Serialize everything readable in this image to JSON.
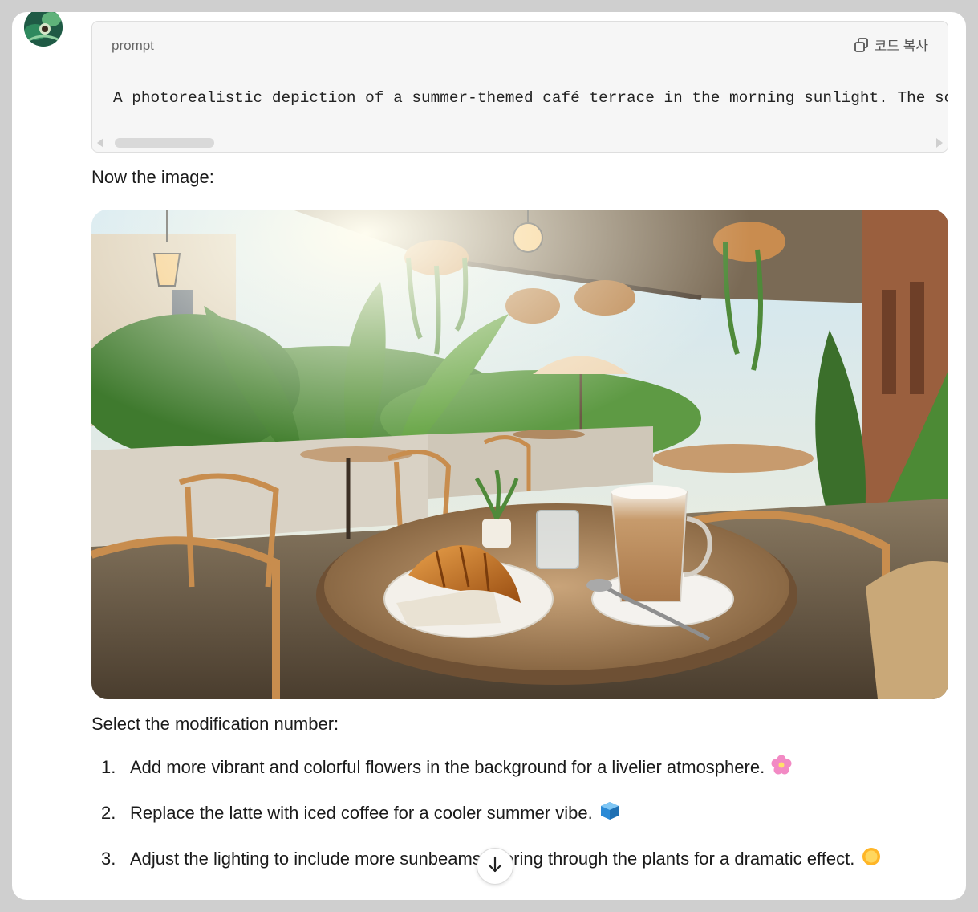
{
  "avatar": {
    "icon": "assistant-avatar-icon"
  },
  "code_block": {
    "language": "prompt",
    "copy_label": "코드 복사",
    "copy_icon": "copy-icon",
    "text": "A photorealistic depiction of a summer-themed café terrace in the morning sunlight. The sc"
  },
  "intro_text": "Now the image:",
  "image": {
    "subject": "café terrace with plants, croissant and latte"
  },
  "select_text": "Select the modification number:",
  "options": [
    {
      "number": "1.",
      "text": "Add more vibrant and colorful flowers in the background for a livelier atmosphere.",
      "emoji": "flower-emoji"
    },
    {
      "number": "2.",
      "text": "Replace the latte with iced coffee for a cooler summer vibe.",
      "emoji": "ice-cube-emoji"
    },
    {
      "number": "3.",
      "text": "Adjust the lighting to include more sunbeams filtering through the plants for a dramatic effect.",
      "emoji": "sun-emoji"
    }
  ],
  "scroll_down": {
    "icon": "arrow-down-icon"
  }
}
